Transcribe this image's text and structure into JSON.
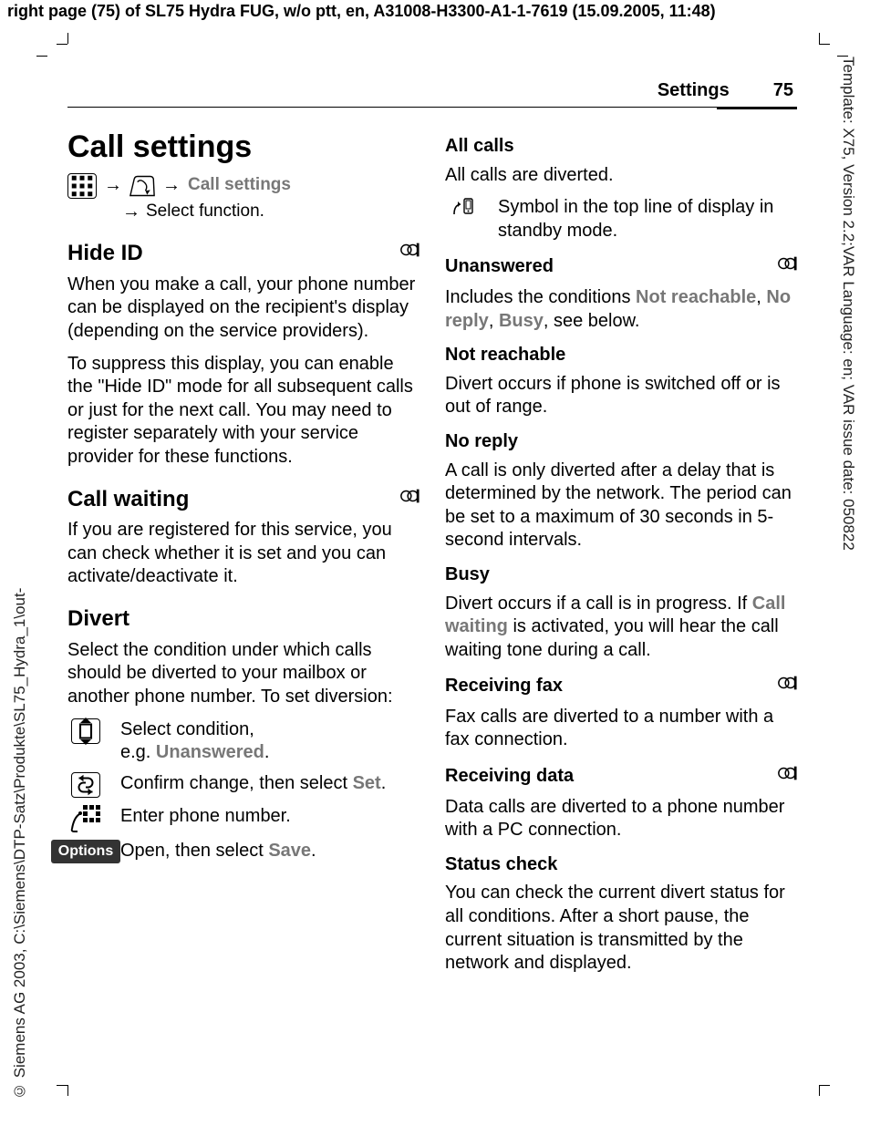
{
  "meta": {
    "topbar_prefix": "right page (75)",
    "topbar_rest": " of SL75 Hydra FUG, w/o ptt, en, A31008-H3300-A1-1-7619 (15.09.2005, 11:48)",
    "side_right": "Template: X75, Version 2.2;VAR Language: en; VAR issue date: 050822",
    "side_left": "© Siemens AG 2003, C:\\Siemens\\DTP-Satz\\Produkte\\SL75_Hydra_1\\out-"
  },
  "header": {
    "section": "Settings",
    "page": "75"
  },
  "left": {
    "h1": "Call settings",
    "nav_target": "Call settings",
    "nav_select": "Select function.",
    "hide_id_h": "Hide ID",
    "hide_id_p1": "When you make a call, your phone number can be displayed on the recipient's display (depending on the service providers).",
    "hide_id_p2": "To suppress this display, you can enable the \"Hide ID\" mode for all subsequent calls or just for the next call. You may need to register separately with your service provider for these functions.",
    "call_wait_h": "Call waiting",
    "call_wait_p": "If you are registered for this service, you can check whether it is set and you can activate/deactivate it.",
    "divert_h": "Divert",
    "divert_p": "Select the condition under which calls should be diverted to your mailbox or another phone number. To set diversion:",
    "steps": {
      "s1a": "Select condition,",
      "s1b": "e.g. ",
      "s1c": "Unanswered",
      "s1d": ".",
      "s2a": "Confirm change, then select ",
      "s2b": "Set",
      "s2c": ".",
      "s3": "Enter phone number.",
      "s4a": "Open, then select ",
      "s4b": "Save",
      "s4c": ".",
      "options_btn": "Options"
    }
  },
  "right": {
    "allcalls_h": "All calls",
    "allcalls_p": "All calls are diverted.",
    "allcalls_sym": "Symbol in the top line of display in standby mode.",
    "unanswered_h": "Unanswered",
    "unanswered_p_a": "Includes the conditions ",
    "unanswered_p_b": "Not reachable",
    "unanswered_p_c": ", ",
    "unanswered_p_d": "No reply",
    "unanswered_p_e": ", ",
    "unanswered_p_f": "Busy",
    "unanswered_p_g": ", see below.",
    "notreach_h": "Not reachable",
    "notreach_p": "Divert occurs if phone is switched off or is out of range.",
    "noreply_h": "No reply",
    "noreply_p": "A call is only diverted after a delay that is determined by the network. The period can be set to a maximum of 30 seconds in 5-second intervals.",
    "busy_h": "Busy",
    "busy_p_a": "Divert occurs if a call is in progress. If ",
    "busy_p_b": "Call waiting",
    "busy_p_c": " is activated, you will hear the call waiting tone during a call.",
    "fax_h": "Receiving fax",
    "fax_p": "Fax calls are diverted to a number with a fax connection.",
    "data_h": "Receiving data",
    "data_p": "Data calls are diverted to a phone number with a PC connection.",
    "status_h": "Status check",
    "status_p": "You can check the current divert status for all conditions. After a short pause, the current situation is transmitted by the network and displayed."
  }
}
